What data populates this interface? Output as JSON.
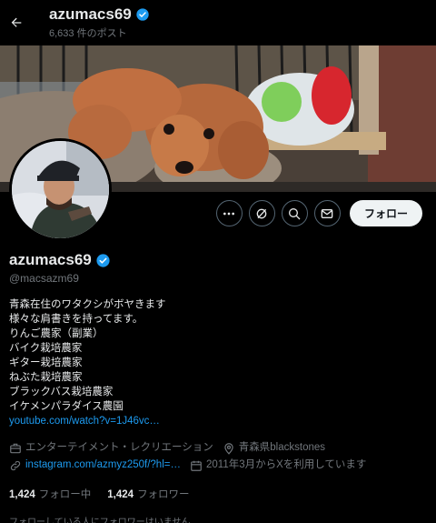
{
  "header": {
    "name": "azumacs69",
    "post_count": "6,633 件のポスト"
  },
  "profile": {
    "display_name": "azumacs69",
    "handle": "@macsazm69",
    "verified_color": "#1d9bf0",
    "bio_lines": [
      "青森在住のワタクシがボヤきます",
      "様々な肩書きを持ってます。",
      "りんご農家（副業）",
      "バイク栽培農家",
      "ギター栽培農家",
      "ねぶた栽培農家",
      "ブラックバス栽培農家",
      "イケメンパラダイス農園"
    ],
    "bio_link": "youtube.com/watch?v=1J46vc…",
    "category": "エンターテイメント・レクリエーション",
    "location": "青森県blackstones",
    "website": "instagram.com/azmyz250f/?hl=…",
    "joined": "2011年3月からXを利用しています"
  },
  "actions": {
    "follow_label": "フォロー",
    "icons": [
      "more-icon",
      "grok-icon",
      "search-icon",
      "message-icon"
    ]
  },
  "stats": {
    "following_count": "1,424",
    "following_label": "フォロー中",
    "followers_count": "1,424",
    "followers_label": "フォロワー"
  },
  "followers_note": "フォローしている人にフォロワーはいません"
}
